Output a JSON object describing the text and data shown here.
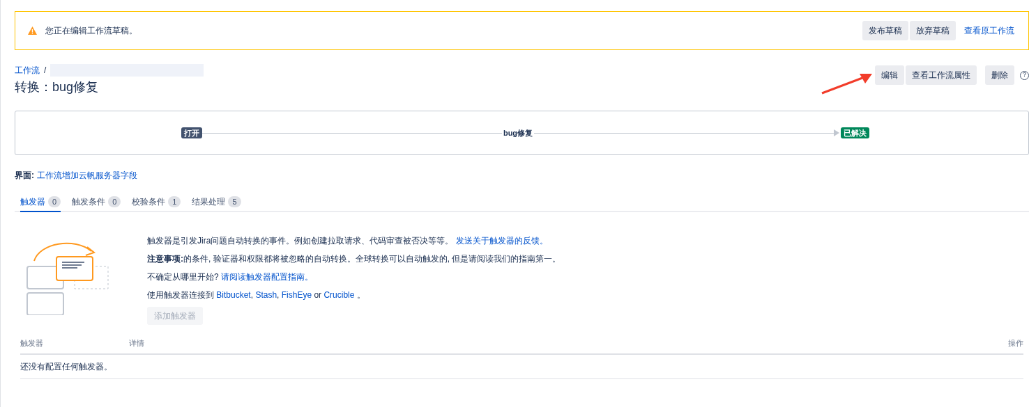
{
  "draft_banner": {
    "message": "您正在编辑工作流草稿。",
    "buttons": [
      "发布草稿",
      "放弃草稿"
    ],
    "link": "查看原工作流"
  },
  "breadcrumb": {
    "link": "工作流",
    "separator": "/"
  },
  "page_title": "转换：bug修复",
  "actions": {
    "buttons": [
      "编辑",
      "查看工作流属性"
    ],
    "delete": "删除",
    "help": "?"
  },
  "diagram": {
    "from": "打开",
    "transition": "bug修复",
    "to": "已解决"
  },
  "screen": {
    "label": "界面:",
    "link": "工作流增加云帆服务器字段"
  },
  "tabs": [
    {
      "label": "触发器",
      "count": "0",
      "selected": true
    },
    {
      "label": "触发条件",
      "count": "0",
      "selected": false
    },
    {
      "label": "校验条件",
      "count": "1",
      "selected": false
    },
    {
      "label": "结果处理",
      "count": "5",
      "selected": false
    }
  ],
  "intro": [
    [
      {
        "kind": "text",
        "text": "触发器是引发Jira问题自动转换的事件。例如创建拉取请求、代码审查被否决等等。 "
      },
      {
        "kind": "link",
        "text": "发送关于触发器的反馈。"
      }
    ],
    [
      {
        "kind": "text",
        "text": "**注意事项:**的条件, 验证器和权限都将被忽略的自动转换。全球转换可以自动触发的, 但是请阅读我们的指南第一。"
      }
    ],
    [
      {
        "kind": "text",
        "text": "不确定从哪里开始? "
      },
      {
        "kind": "link",
        "text": "请阅读触发器配置指南。"
      }
    ],
    [
      {
        "kind": "text",
        "text": "使用触发器连接到 "
      },
      {
        "kind": "link",
        "text": "Bitbucket"
      },
      {
        "kind": "text",
        "text": ", "
      },
      {
        "kind": "link",
        "text": "Stash"
      },
      {
        "kind": "text",
        "text": ", "
      },
      {
        "kind": "link",
        "text": "FishEye"
      },
      {
        "kind": "text",
        "text": " or "
      },
      {
        "kind": "link",
        "text": "Crucible"
      },
      {
        "kind": "text",
        "text": " 。"
      }
    ]
  ],
  "add_button": {
    "label": "添加触发器",
    "disabled": true
  },
  "table": {
    "columns": [
      "触发器",
      "详情",
      "操作"
    ],
    "empty_message": "还没有配置任何触发器。"
  }
}
